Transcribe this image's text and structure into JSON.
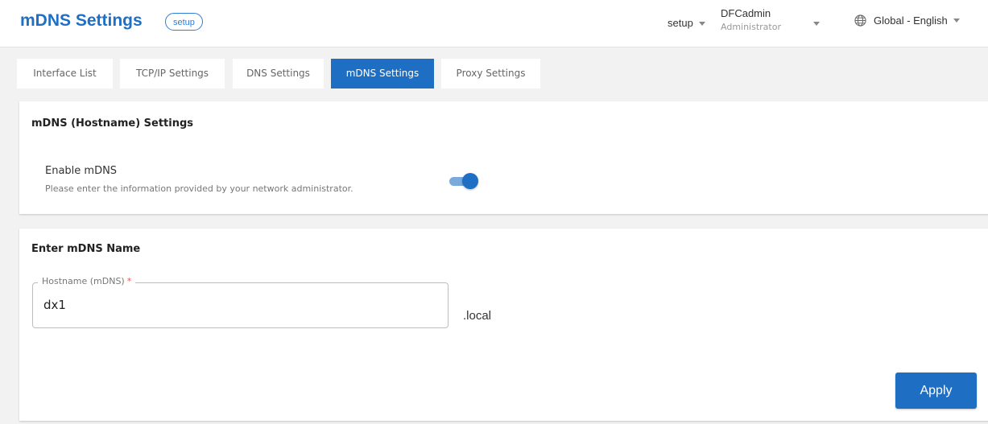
{
  "header": {
    "title": "mDNS Settings",
    "badge": "setup",
    "setup_menu": "setup",
    "user_name": "DFCadmin",
    "user_role": "Administrator",
    "language": "Global - English"
  },
  "tabs": [
    {
      "label": "Interface List",
      "active": false
    },
    {
      "label": "TCP/IP Settings",
      "active": false
    },
    {
      "label": "DNS Settings",
      "active": false
    },
    {
      "label": "mDNS Settings",
      "active": true
    },
    {
      "label": "Proxy Settings",
      "active": false
    }
  ],
  "hostname_section": {
    "title": "mDNS (Hostname) Settings",
    "enable_label": "Enable mDNS",
    "enable_desc": "Please enter the information provided by your network administrator.",
    "enabled": true
  },
  "name_section": {
    "title": "Enter mDNS Name",
    "field_label": "Hostname (mDNS)",
    "required_mark": "*",
    "field_value": "dx1",
    "suffix": ".local",
    "apply_label": "Apply"
  },
  "colors": {
    "accent": "#1e6fc4",
    "toggle_track": "#7aa9dc",
    "required": "#e05555"
  }
}
